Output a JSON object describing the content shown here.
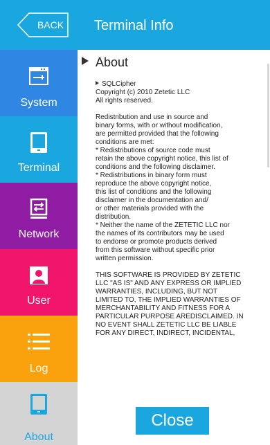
{
  "header": {
    "back_label": "BACK",
    "title": "Terminal Info"
  },
  "sidebar": {
    "items": [
      {
        "label": "System",
        "icon": "system-icon",
        "color": "#2f86e3"
      },
      {
        "label": "Terminal",
        "icon": "terminal-icon",
        "color": "#1aa7e0"
      },
      {
        "label": "Network",
        "icon": "network-icon",
        "color": "#8f1ca3"
      },
      {
        "label": "User",
        "icon": "user-icon",
        "color": "#f0146a"
      },
      {
        "label": "Log",
        "icon": "log-icon",
        "color": "#f9a20e"
      },
      {
        "label": "About",
        "icon": "about-icon",
        "color": "#d4d4d4",
        "selected": true
      }
    ]
  },
  "content": {
    "section_title": "About",
    "sub_title": "SQLCipher",
    "paragraphs": [
      "Copyright (c) 2010 Zetetic LLC\nAll rights reserved.",
      "Redistribution and use in source and\nbinary forms, with or without modification,\nare permitted provided that the following\nconditions are met:\n* Redistributions of source code must\nretain the above copyright notice, this list of\nconditions and the following disclaimer.\n* Redistributions in binary form must\nreproduce the above copyright notice,\nthis list of conditions and the following\ndisclaimer in the documentation and/\nor other materials provided with the\ndistribution.\n* Neither the name of the ZETETIC LLC nor\nthe names of its contributors may be used\nto endorse or promote products derived\nfrom this software without specific prior\nwritten permission.",
      "THIS SOFTWARE IS PROVIDED BY ZETETIC\nLLC \"AS IS\" AND ANY EXPRESS OR IMPLIED\nWARRANTIES, INCLUDING, BUT NOT\nLIMITED TO, THE IMPLIED WARRANTIES OF\nMERCHANTABILITY AND FITNESS FOR A\nPARTICULAR PURPOSE AREDISCLAIMED. IN\nNO EVENT SHALL ZETETIC LLC BE LIABLE\nFOR ANY DIRECT, INDIRECT, INCIDENTAL,"
    ],
    "close_label": "Close"
  }
}
